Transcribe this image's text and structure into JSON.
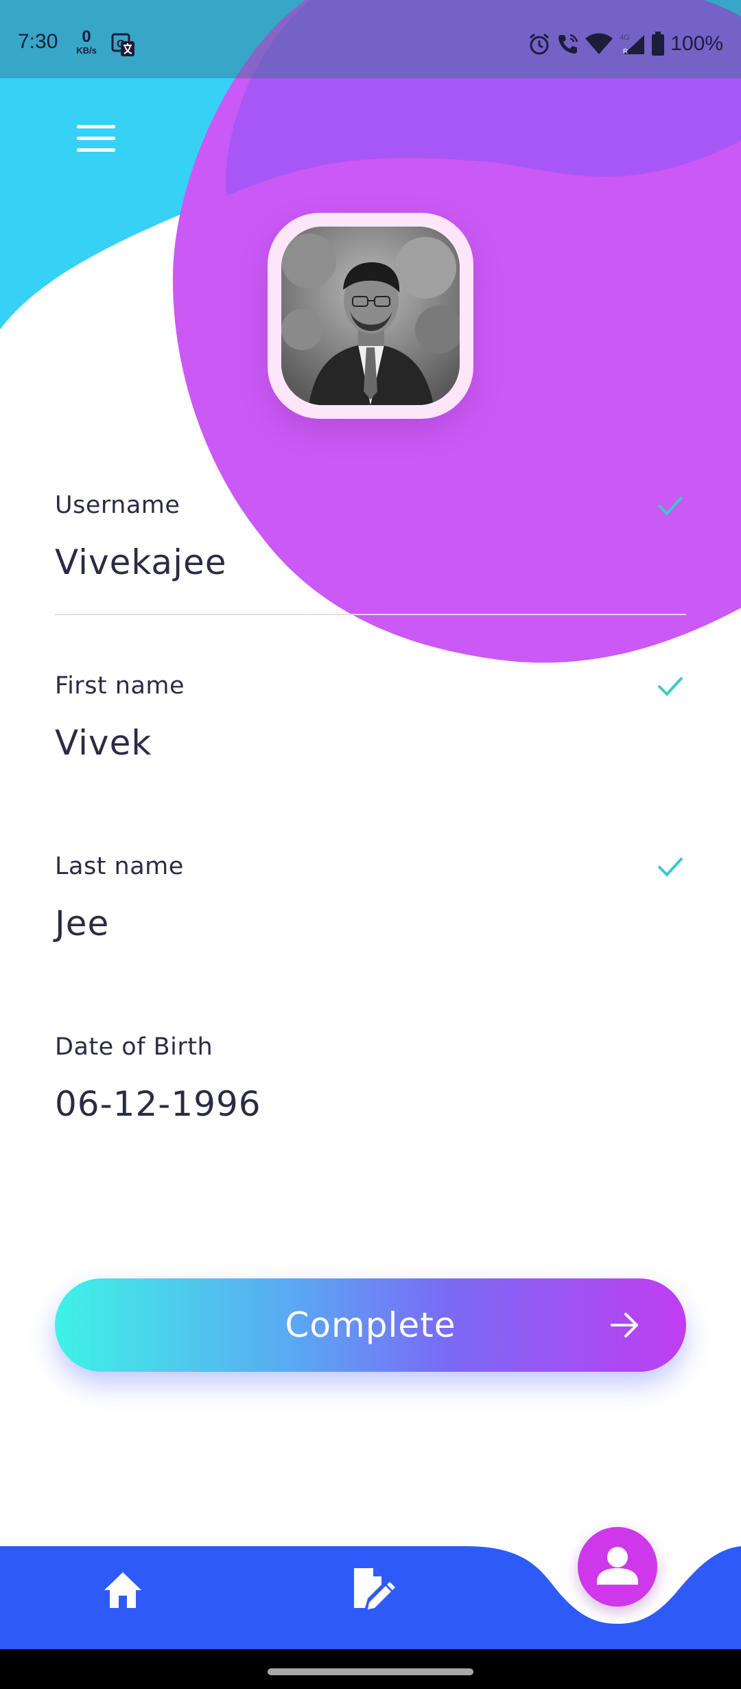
{
  "colors": {
    "cyan": "#36d1f5",
    "purple": "#cb59f5",
    "blue_nav": "#2e5bf8",
    "fab": "#ce38ea",
    "check": "#3cc8c8",
    "text": "#2b2b45"
  },
  "status_bar": {
    "time": "7:30",
    "speed_value": "0",
    "speed_unit": "KB/s",
    "battery": "100%",
    "icons": [
      "translate-icon",
      "alarm-icon",
      "wifi-call-icon",
      "wifi-icon",
      "signal-4g-icon",
      "battery-icon"
    ]
  },
  "header": {
    "menu_icon": "hamburger-menu-icon"
  },
  "profile": {
    "avatar_icon": "profile-photo"
  },
  "form": {
    "fields": [
      {
        "label": "Username",
        "value": "Vivekajee",
        "verified": true
      },
      {
        "label": "First name",
        "value": "Vivek",
        "verified": true
      },
      {
        "label": "Last name",
        "value": "Jee",
        "verified": true
      },
      {
        "label": "Date of Birth",
        "value": "06-12-1996",
        "verified": false
      }
    ]
  },
  "complete_button": {
    "label": "Complete",
    "icon": "arrow-right-icon"
  },
  "bottom_nav": {
    "items": [
      {
        "icon": "home-icon",
        "active": false
      },
      {
        "icon": "edit-document-icon",
        "active": false
      },
      {
        "icon": "profile-icon",
        "active": true
      }
    ]
  }
}
